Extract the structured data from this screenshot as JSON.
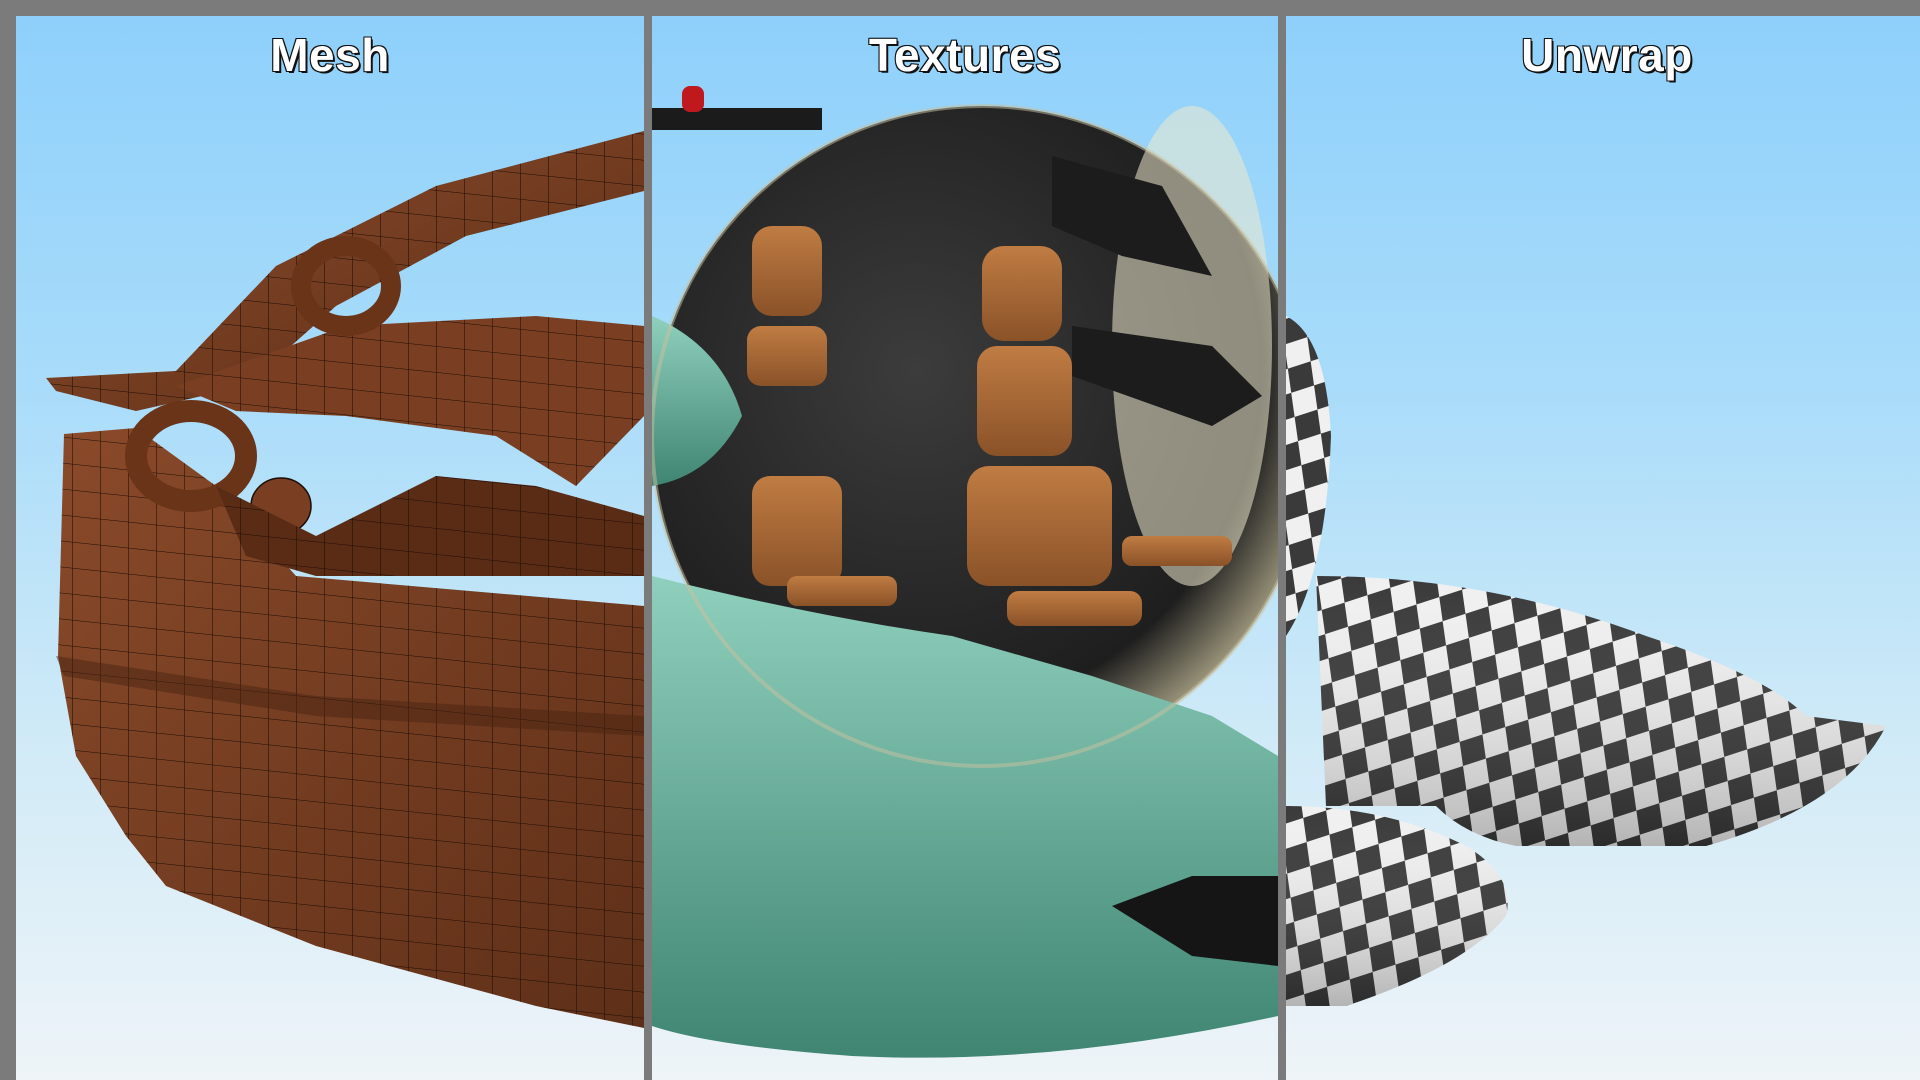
{
  "panels": [
    {
      "title": "Mesh"
    },
    {
      "title": "Textures"
    },
    {
      "title": "Unwrap"
    }
  ],
  "colors": {
    "frame": "#7b7b7b",
    "sky_top": "#8ed0fb",
    "sky_bottom": "#eef4f8",
    "mesh_brown": "#7a3f22",
    "hull_teal": "#6fb8a6",
    "seat_tan": "#b06c37",
    "checker_dark": "#3a3a3a",
    "checker_light": "#f2f2f2"
  }
}
